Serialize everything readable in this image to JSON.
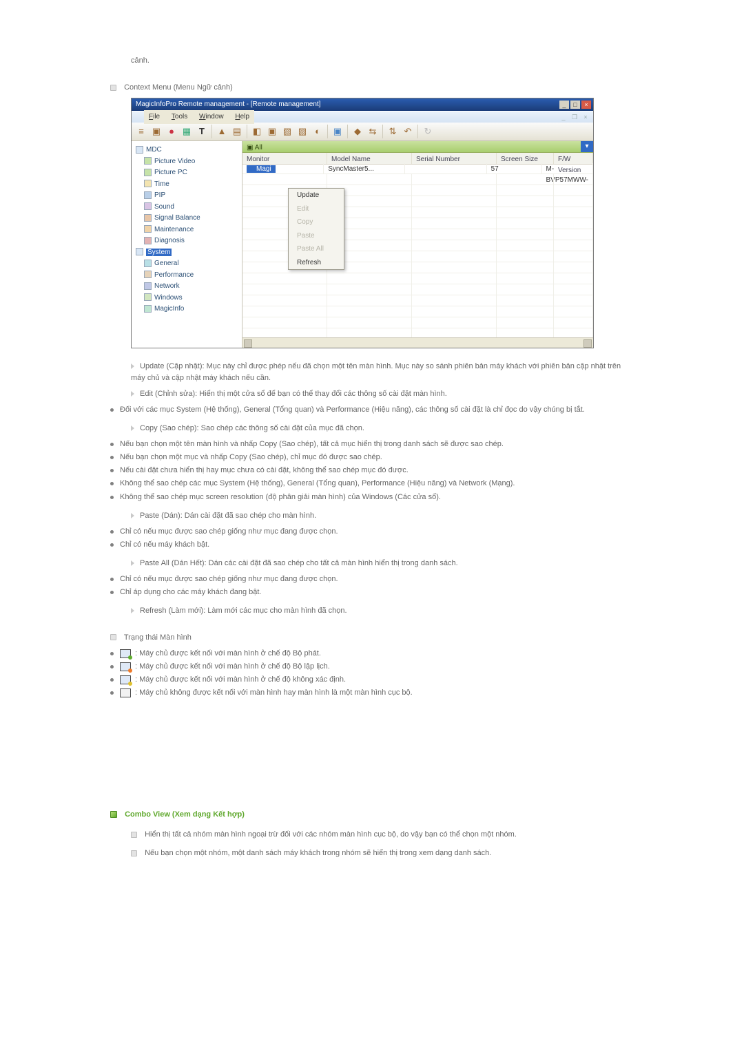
{
  "intro_tail": "cảnh.",
  "context_menu_title": "Context Menu (Menu Ngữ cảnh)",
  "app": {
    "title": "MagicInfoPro Remote management - [Remote management]",
    "subtitle_menu": [
      "File",
      "Tools",
      "Window",
      "Help"
    ],
    "win_controls": {
      "min": "_",
      "max": "□",
      "close": "×"
    },
    "toolbar_icons": [
      "≡",
      "▣",
      "●",
      "▦",
      "T",
      "▲",
      "▤",
      "◧",
      "▣",
      "▧",
      "▨",
      "◐",
      "▣",
      "◆",
      "⇆",
      "⇅",
      "↶",
      "↻",
      "ⓘ"
    ],
    "group_label": "All",
    "tree": {
      "root": "MDC",
      "items": [
        "Picture Video",
        "Picture PC",
        "Time",
        "PIP",
        "Sound",
        "Signal Balance",
        "Maintenance",
        "Diagnosis"
      ],
      "sys_root": "System",
      "sys_items": [
        "General",
        "Performance",
        "Network",
        "Windows",
        "MagicInfo"
      ]
    },
    "grid": {
      "cols": [
        "Monitor",
        "Model Name",
        "Serial Number",
        "Screen Size",
        "F/W Version"
      ],
      "row": {
        "monitor": "Magi",
        "model": "SyncMaster5...",
        "serial": "",
        "size": "57",
        "fw": "M-BVP57MWW-"
      }
    },
    "context_menu": {
      "items": [
        "Update",
        "Edit",
        "Copy",
        "Paste",
        "Paste All",
        "Refresh"
      ],
      "disabled": [
        1,
        2,
        3,
        4
      ]
    }
  },
  "update_text": "Update (Cập nhật): Mục này chỉ được phép nếu đã chọn một tên màn hình. Mục này so sánh phiên bản máy khách với phiên bản cập nhật trên máy chủ và cập nhật máy khách nếu cần.",
  "edit_text": "Edit (Chỉnh sửa): Hiển thị một cửa sổ để bạn có thể thay đổi các thông số cài đặt màn hình.",
  "edit_sub": [
    "Đối với các mục System (Hệ thống), General (Tổng quan) và Performance (Hiệu năng), các thông số cài đặt là chỉ đọc do vậy chúng bị tắt."
  ],
  "copy_text": "Copy (Sao chép): Sao chép các thông số cài đặt của mục đã chọn.",
  "copy_sub": [
    "Nếu bạn chọn một tên màn hình và nhấp Copy (Sao chép), tất cả mục hiển thị trong danh sách sẽ được sao chép.",
    "Nếu bạn chọn một mục và nhấp Copy (Sao chép), chỉ mục đó được sao chép.",
    "Nếu cài đặt chưa hiển thị hay mục chưa có cài đặt, không thể sao chép mục đó được.",
    "Không thể sao chép các mục System (Hệ thống), General (Tổng quan), Performance (Hiệu năng) và Network (Mạng).",
    "Không thể sao chép mục screen resolution (độ phân giải màn hình) của Windows (Các cửa sổ)."
  ],
  "paste_text": "Paste (Dán): Dán cài đặt đã sao chép cho màn hình.",
  "paste_sub": [
    "Chỉ có nếu mục được sao chép giống như mục đang được chọn.",
    "Chỉ có nếu máy khách bật."
  ],
  "pasteall_text": "Paste All (Dán Hết): Dán các cài đặt đã sao chép cho tất cả màn hình hiển thị trong danh sách.",
  "pasteall_sub": [
    "Chỉ có nếu mục được sao chép giống như mục đang được chọn.",
    "Chỉ áp dụng cho các máy khách đang bật."
  ],
  "refresh_text": "Refresh (Làm mới): Làm mới các mục cho màn hình đã chọn.",
  "status_title": "Trạng thái Màn hình",
  "status_items": [
    ": Máy chủ được kết nối với màn hình ở chế độ Bộ phát.",
    ": Máy chủ được kết nối với màn hình ở chế độ Bộ lập lịch.",
    ": Máy chủ được kết nối với màn hình ở chế độ không xác định.",
    ": Máy chủ không được kết nối với màn hình hay màn hình là một màn hình cục bộ."
  ],
  "combo_title": "Combo View (Xem dạng Kết hợp)",
  "combo_items": [
    "Hiển thị tất cả nhóm màn hình ngoại trừ đối với các nhóm màn hình cục bộ, do vậy bạn có thể chọn một nhóm.",
    "Nếu bạn chọn một nhóm, một danh sách máy khách trong nhóm sẽ hiển thị trong xem dạng danh sách."
  ]
}
